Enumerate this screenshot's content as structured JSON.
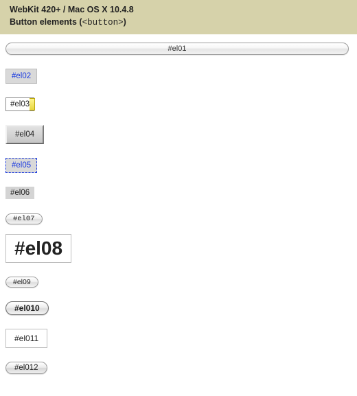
{
  "header": {
    "line1": "WebKit 420+ / Mac OS X 10.4.8",
    "line2_pre": "Button elements (",
    "line2_tag": "<button>",
    "line2_post": ")"
  },
  "buttons": {
    "el01": "#el01",
    "el02": "#el02",
    "el03": "#el03",
    "el04": "#el04",
    "el05": "#el05",
    "el06": "#el06",
    "el07": "#el07",
    "el08": "#el08",
    "el09": "#el09",
    "el010": "#el010",
    "el011": "#el011",
    "el012": "#el012"
  }
}
